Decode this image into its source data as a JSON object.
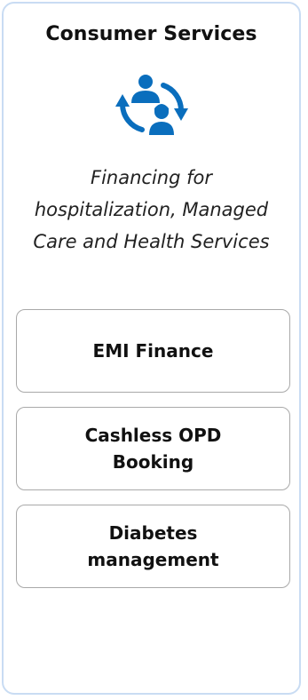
{
  "card": {
    "title": "Consumer Services",
    "icon": "people-cycle-icon",
    "description": "Financing for hospitalization, Managed Care and Health Services"
  },
  "services": [
    {
      "label": "EMI Finance"
    },
    {
      "label": "Cashless OPD\nBooking"
    },
    {
      "label": "Diabetes\nmanagement"
    }
  ],
  "colors": {
    "icon_blue": "#0a6ebd",
    "card_border": "#c9dcf3",
    "button_border": "#a9a9a9"
  }
}
